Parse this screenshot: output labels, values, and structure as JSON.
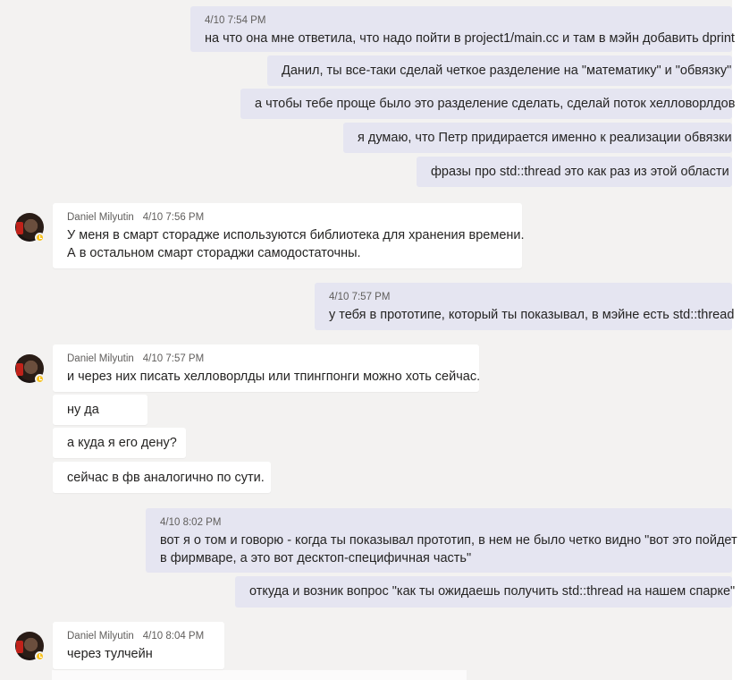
{
  "messages": [
    {
      "id": "m1",
      "type": "out",
      "time": "4/10 7:54 PM",
      "lines": [
        "на что она мне ответила, что надо пойти в project1/main.cc и там в мэйн добавить dprint"
      ]
    },
    {
      "id": "m2",
      "type": "out",
      "lines": [
        "Данил, ты все-таки сделай четкое разделение на \"математику\" и \"обвязку\""
      ]
    },
    {
      "id": "m3",
      "type": "out",
      "lines": [
        "а чтобы тебе проще было это разделение сделать, сделай поток хелловорлдов"
      ]
    },
    {
      "id": "m4",
      "type": "out",
      "lines": [
        "я думаю, что Петр придирается именно к реализации обвязки"
      ]
    },
    {
      "id": "m5",
      "type": "out",
      "lines": [
        "фразы про std::thread это как раз из этой области"
      ]
    },
    {
      "id": "m6",
      "type": "in",
      "author": "Daniel Milyutin",
      "time": "4/10 7:56 PM",
      "lines": [
        "У меня в смарт сторадже используются библиотека для хранения времени.",
        "А в остальном смарт стораджи самодостаточны."
      ]
    },
    {
      "id": "m7",
      "type": "out",
      "time": "4/10 7:57 PM",
      "lines": [
        "у тебя в прототипе, который ты показывал, в мэйне есть std::thread"
      ]
    },
    {
      "id": "m8",
      "type": "in",
      "author": "Daniel Milyutin",
      "time": "4/10 7:57 PM",
      "lines": [
        "и через них писать хелловорлды или тпингпонги можно хоть сейчас."
      ]
    },
    {
      "id": "m9",
      "type": "in",
      "lines": [
        "ну да"
      ]
    },
    {
      "id": "m10",
      "type": "in",
      "lines": [
        "а куда я его дену?"
      ]
    },
    {
      "id": "m11",
      "type": "in",
      "lines": [
        "сейчас в фв аналогично по сути."
      ]
    },
    {
      "id": "m12",
      "type": "out",
      "time": "4/10 8:02 PM",
      "lines": [
        "вот я о том и говорю - когда ты показывал прототип, в нем не было четко видно \"вот это пойдет",
        "в фирмваре, а это вот десктоп-специфичная часть\""
      ]
    },
    {
      "id": "m13",
      "type": "out",
      "lines": [
        "откуда и возник вопрос \"как ты ожидаешь получить std::thread на нашем спарке\""
      ]
    },
    {
      "id": "m14",
      "type": "in",
      "author": "Daniel Milyutin",
      "time": "4/10 8:04 PM",
      "lines": [
        "через тулчейн"
      ]
    }
  ],
  "icons": {
    "avatar": "user-avatar-photo",
    "status": "away-clock-status-icon"
  },
  "colors": {
    "outgoing_bubble": "#e5e5f1",
    "incoming_bubble": "#ffffff",
    "background": "#f3f2f1",
    "status_away": "#f8c21d"
  }
}
